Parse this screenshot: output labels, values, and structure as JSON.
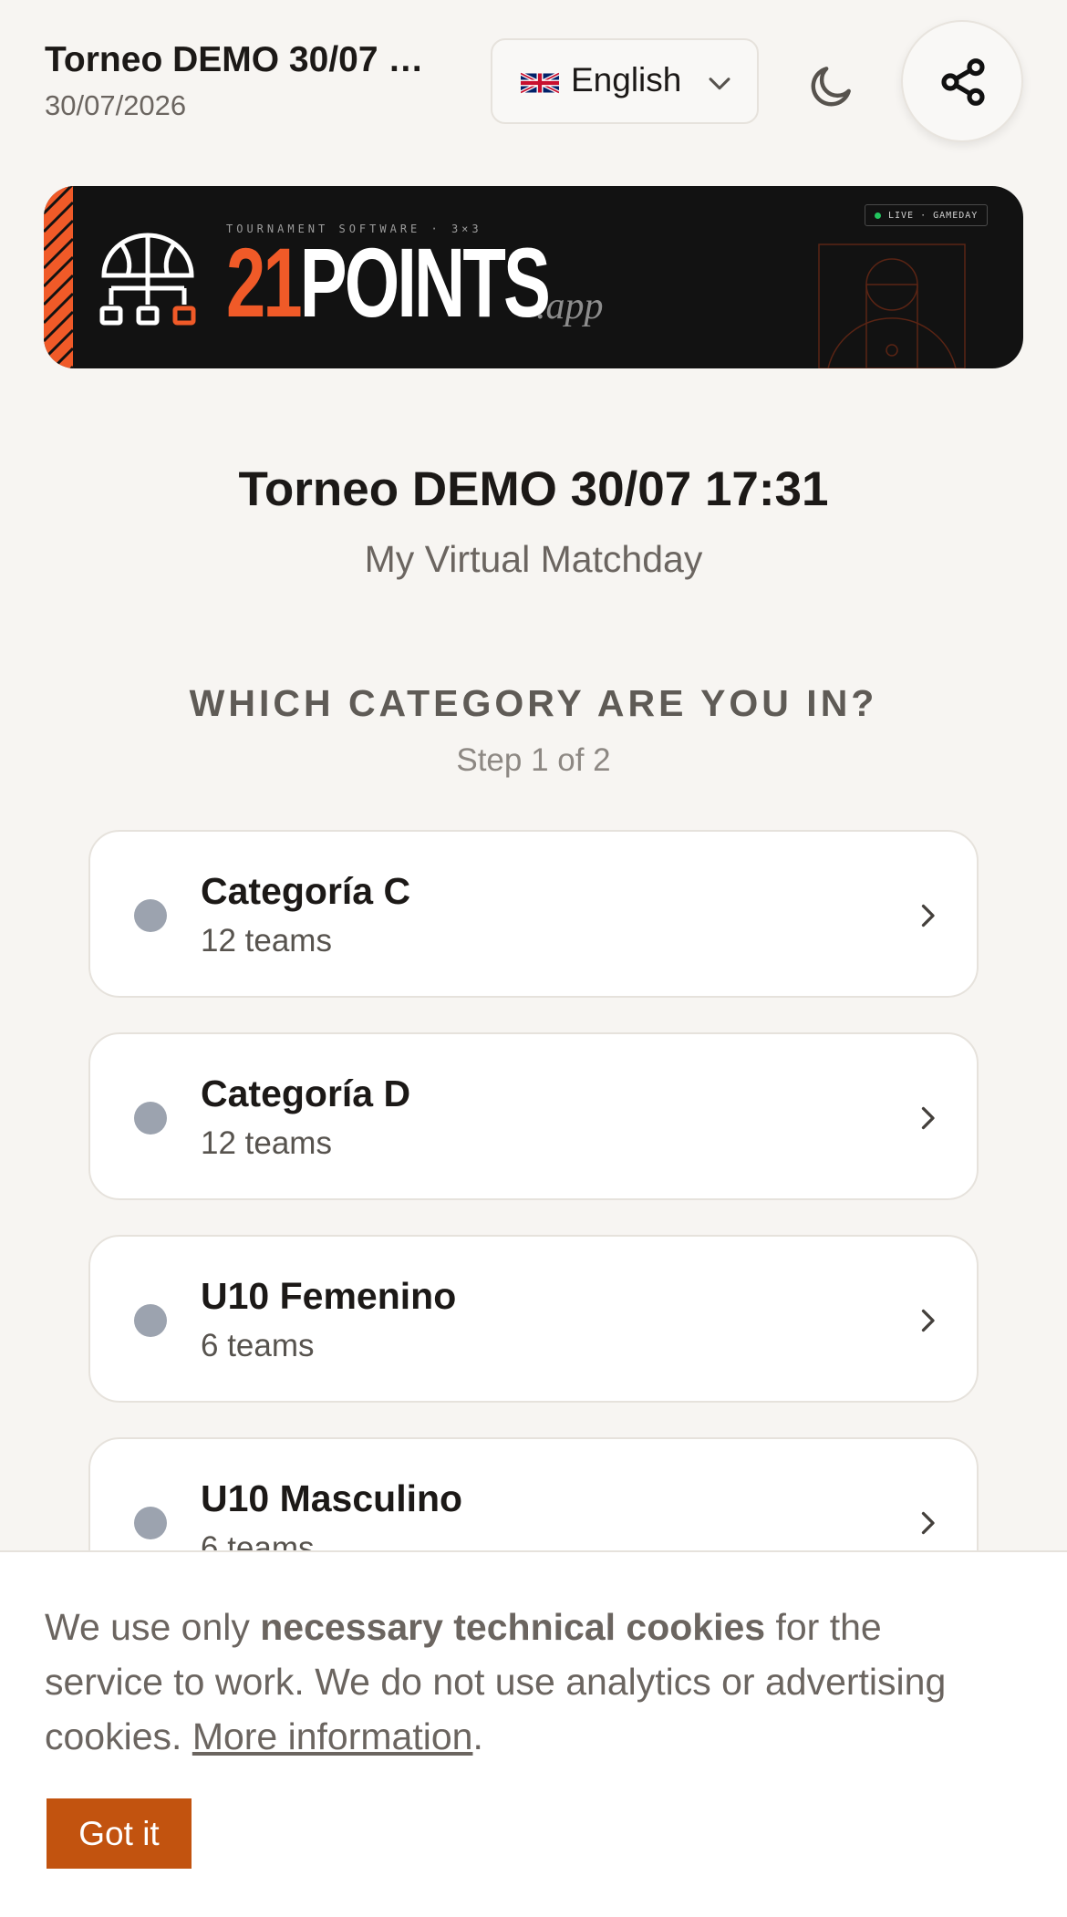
{
  "header": {
    "title": "Torneo DEMO 30/07 …",
    "date": "30/07/2026",
    "language": {
      "selected": "English",
      "flag": "uk-flag"
    },
    "theme_icon": "moon-icon",
    "share_icon": "share-icon"
  },
  "banner": {
    "kicker": "TOURNAMENT SOFTWARE · 3×3",
    "brand_number": "21",
    "brand_word": "POINTS",
    "brand_suffix": ".app",
    "badge": "LIVE · GAMEDAY",
    "accent_color": "#f05a28"
  },
  "main": {
    "title": "Torneo DEMO 30/07 17:31",
    "subtitle": "My Virtual Matchday",
    "question": "WHICH CATEGORY ARE YOU IN?",
    "step": "Step 1 of 2",
    "categories": [
      {
        "name": "Categoría C",
        "teams": "12 teams"
      },
      {
        "name": "Categoría D",
        "teams": "12 teams"
      },
      {
        "name": "U10 Femenino",
        "teams": "6 teams"
      },
      {
        "name": "U10 Masculino",
        "teams": "6 teams"
      }
    ]
  },
  "cookie": {
    "text_before": "We use only ",
    "text_bold": "necessary technical cookies",
    "text_after": " for the service to work. We do not use analytics or advertising cookies. ",
    "link": "More information",
    "text_end": ".",
    "button": "Got it",
    "button_color": "#c2530f"
  }
}
